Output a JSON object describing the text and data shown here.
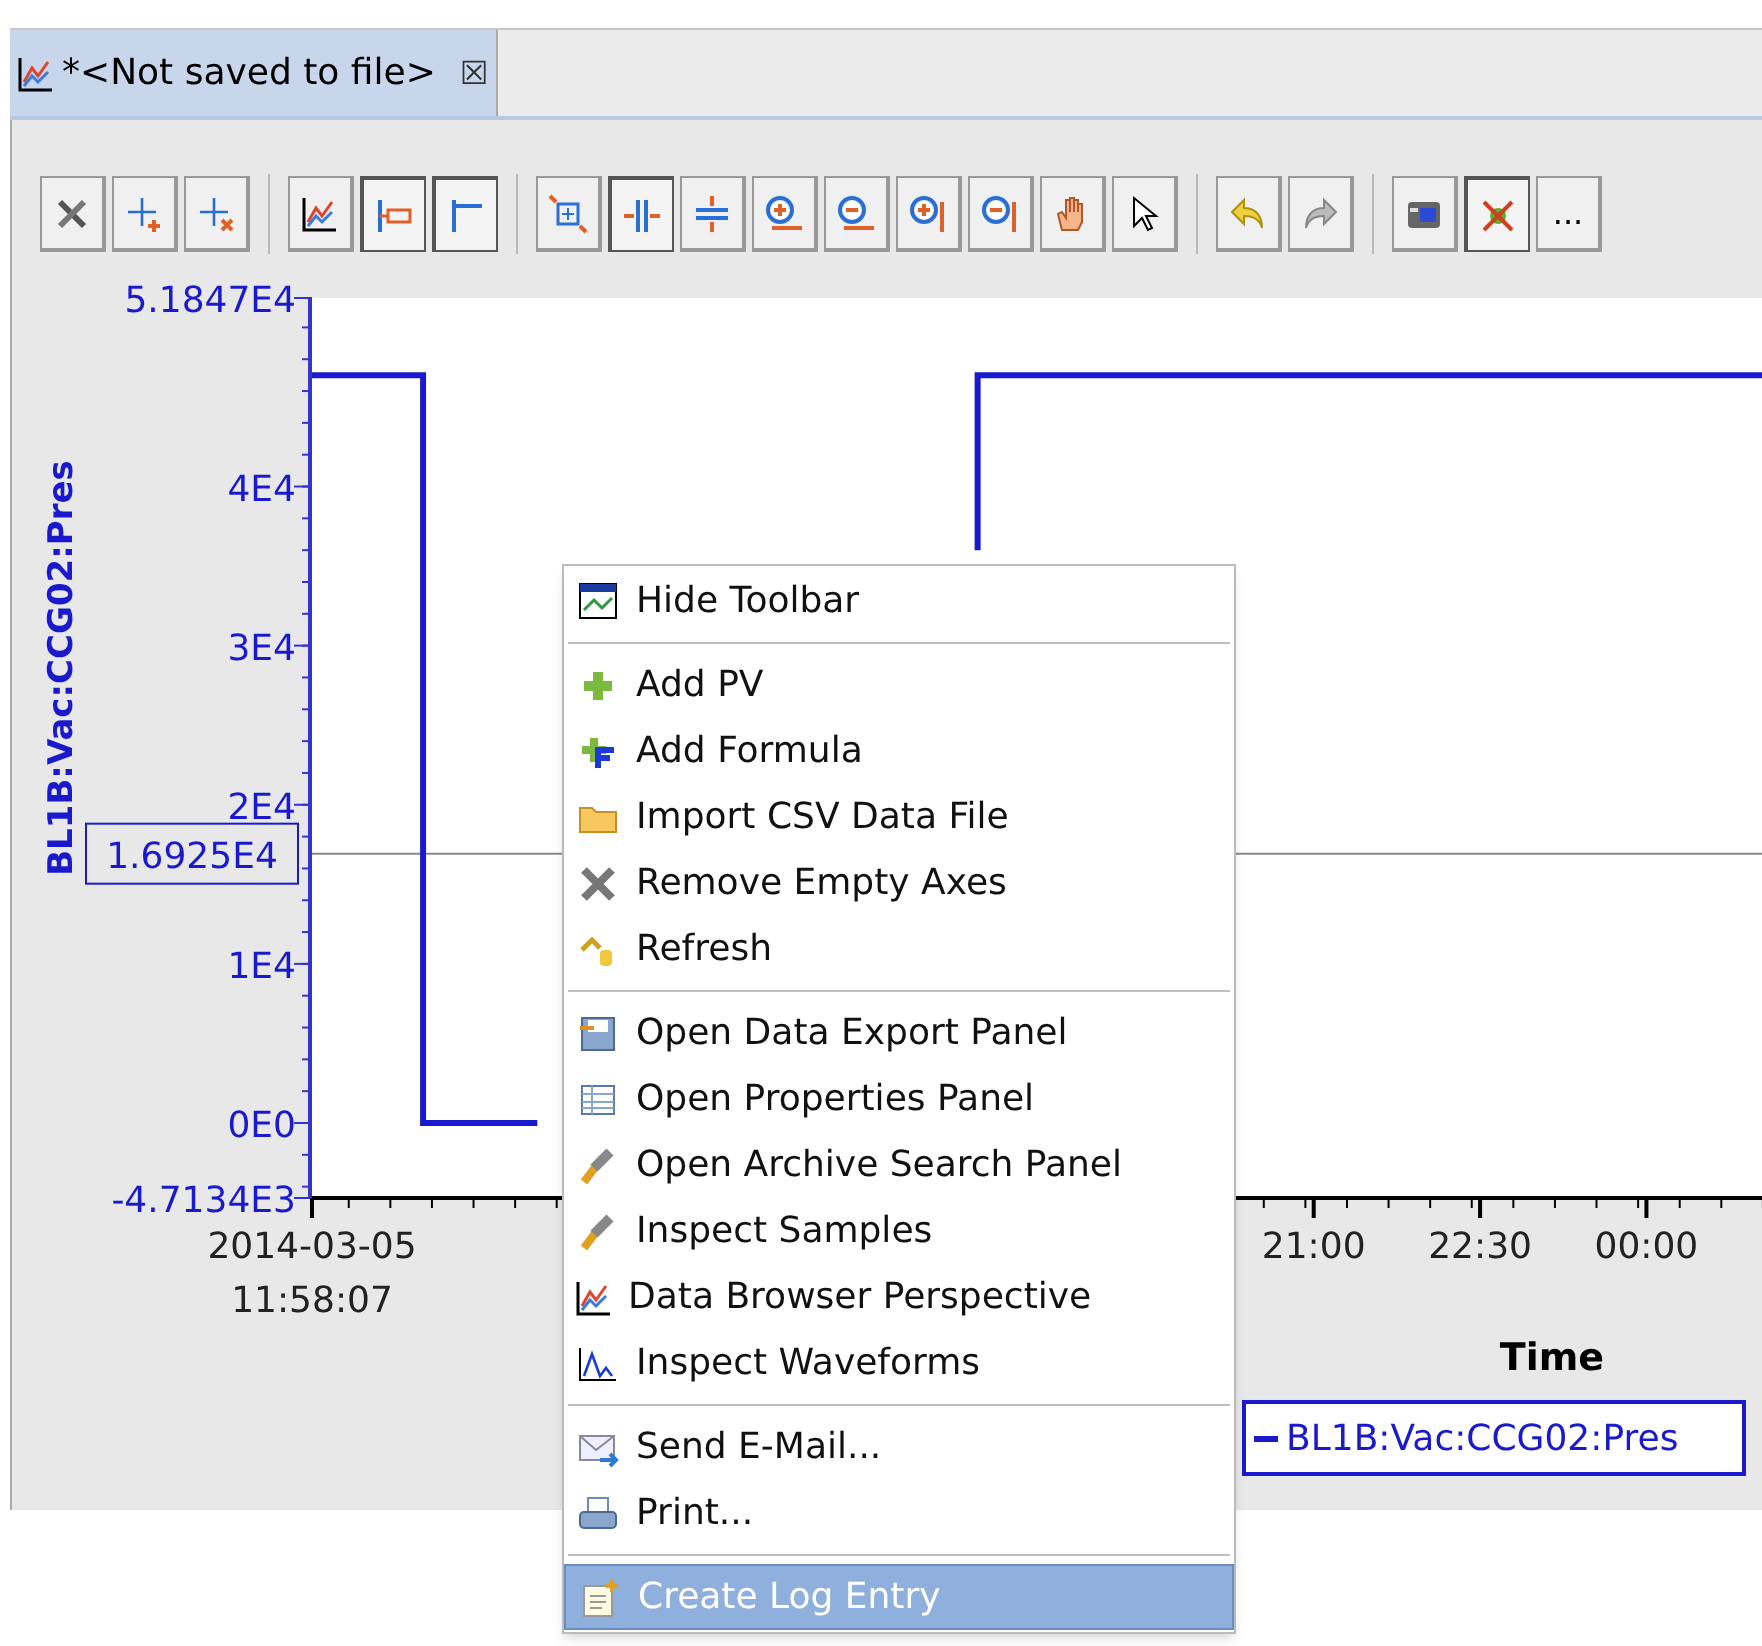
{
  "tab": {
    "title": "*<Not saved to file>",
    "close": "☒",
    "selected": true
  },
  "toolbar": [
    {
      "pressed": false
    },
    {
      "pressed": false
    },
    {
      "pressed": false
    },
    {
      "pressed": false
    },
    {
      "pressed": true
    },
    {
      "pressed": true
    },
    {
      "pressed": false
    },
    {
      "pressed": true
    },
    {
      "pressed": false
    },
    {
      "pressed": false
    },
    {
      "pressed": false
    },
    {
      "pressed": false
    },
    {
      "pressed": false
    },
    {
      "pressed": false
    },
    {
      "pressed": false
    },
    {
      "pressed": false
    },
    {
      "pressed": false
    },
    {
      "pressed": false
    },
    {
      "pressed": true
    },
    {
      "label": "...",
      "pressed": false
    }
  ],
  "chart": {
    "chart_data": {
      "type": "line",
      "xlabel": "Time",
      "ylabel": "BL1B:Vac:CCG02:Pres",
      "ylim": [
        -4713.4,
        51847
      ],
      "xlim": [
        11.9686,
        25.06
      ],
      "yticks": [
        {
          "value": 51847,
          "label": "5.1847E4"
        },
        {
          "value": 40000,
          "label": "4E4"
        },
        {
          "value": 30000,
          "label": "3E4"
        },
        {
          "value": 20000,
          "label": "2E4"
        },
        {
          "value": 10000,
          "label": "1E4"
        },
        {
          "value": 0,
          "label": "0E0"
        },
        {
          "value": -4713.4,
          "label": "-4.7134E3"
        }
      ],
      "xticks": [
        {
          "value": 11.9686,
          "label": "2014-03-05\n11:58:07"
        },
        {
          "value": 21,
          "label": "21:00"
        },
        {
          "value": 22.5,
          "label": "22:30"
        },
        {
          "value": 24,
          "label": "00:00"
        }
      ],
      "series": [
        {
          "name": "BL1B:Vac:CCG02:Pres",
          "color": "#1a1acc",
          "x": [
            11.9686,
            12.97,
            12.97,
            14.0,
            null,
            17.97,
            17.97,
            25.06
          ],
          "values": [
            47000,
            47000,
            0,
            0,
            null,
            36000,
            47000,
            47000
          ]
        }
      ],
      "ref_lines": [
        {
          "axis": "y",
          "value": 16925,
          "label": "1.6925E4"
        }
      ]
    }
  },
  "menu": [
    {
      "kind": "item",
      "label": "Hide Toolbar",
      "selected": false
    },
    {
      "kind": "separator"
    },
    {
      "kind": "item",
      "label": "Add PV",
      "selected": false
    },
    {
      "kind": "item",
      "label": "Add Formula",
      "selected": false
    },
    {
      "kind": "item",
      "label": "Import CSV Data File",
      "selected": false
    },
    {
      "kind": "item",
      "label": "Remove Empty Axes",
      "selected": false
    },
    {
      "kind": "item",
      "label": "Refresh",
      "selected": false
    },
    {
      "kind": "separator"
    },
    {
      "kind": "item",
      "label": "Open Data Export Panel",
      "selected": false
    },
    {
      "kind": "item",
      "label": "Open Properties Panel",
      "selected": false
    },
    {
      "kind": "item",
      "label": "Open Archive Search Panel",
      "selected": false
    },
    {
      "kind": "item",
      "label": "Inspect Samples",
      "selected": false
    },
    {
      "kind": "item",
      "label": "Data Browser Perspective",
      "selected": false
    },
    {
      "kind": "item",
      "label": "Inspect Waveforms",
      "selected": false
    },
    {
      "kind": "separator"
    },
    {
      "kind": "item",
      "label": "Send E-Mail...",
      "selected": false
    },
    {
      "kind": "item",
      "label": "Print...",
      "selected": false
    },
    {
      "kind": "separator"
    },
    {
      "kind": "item",
      "label": "Create Log Entry",
      "selected": true
    }
  ]
}
